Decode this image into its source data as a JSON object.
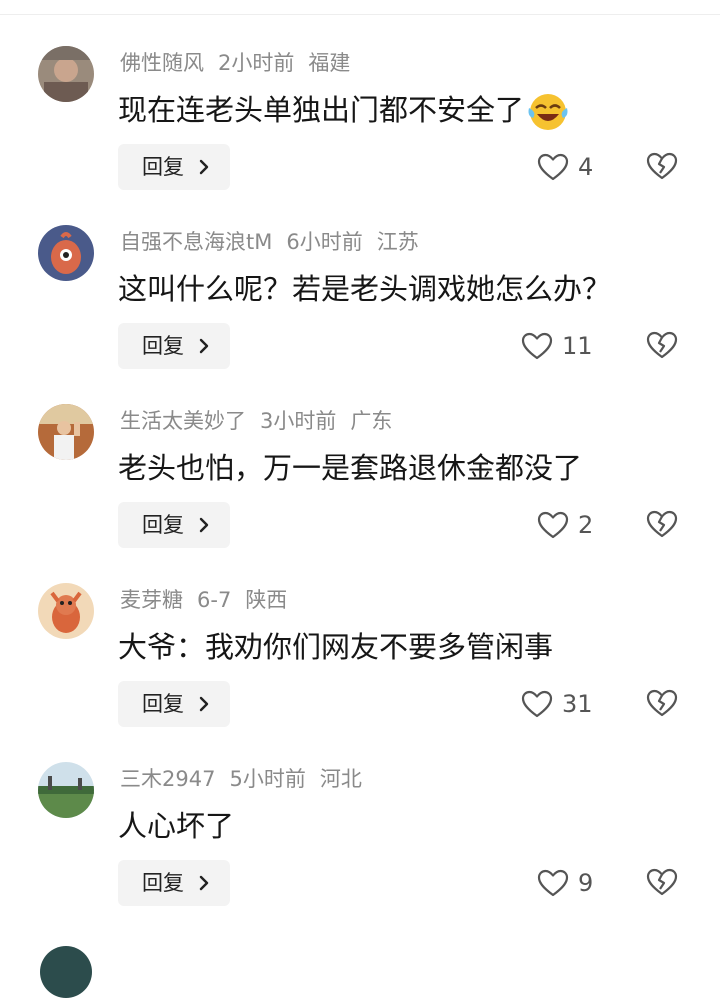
{
  "reply_label": "回复",
  "comments": [
    {
      "username": "佛性随风",
      "time": "2小时前",
      "location": "福建",
      "text": "现在连老头单独出门都不安全了",
      "emoji": "laughing-crying-emoji",
      "likes": "4"
    },
    {
      "username": "自强不息海浪tM",
      "time": "6小时前",
      "location": "江苏",
      "text": "这叫什么呢？若是老头调戏她怎么办？",
      "likes": "11"
    },
    {
      "username": "生活太美妙了",
      "time": "3小时前",
      "location": "广东",
      "text": "老头也怕，万一是套路退休金都没了",
      "likes": "2"
    },
    {
      "username": "麦芽糖",
      "time": "6-7",
      "location": "陕西",
      "text": "大爷：我劝你们网友不要多管闲事",
      "likes": "31"
    },
    {
      "username": "三木2947",
      "time": "5小时前",
      "location": "河北",
      "text": "人心坏了",
      "likes": "9"
    }
  ],
  "icons": {
    "like": "heart-outline-icon",
    "dislike": "broken-heart-icon",
    "reply_arrow": "chevron-right-icon"
  },
  "colors": {
    "meta_text": "#8a8a8a",
    "comment_text": "#161616",
    "reply_bg": "#f3f3f3",
    "icon_stroke": "#555555"
  }
}
